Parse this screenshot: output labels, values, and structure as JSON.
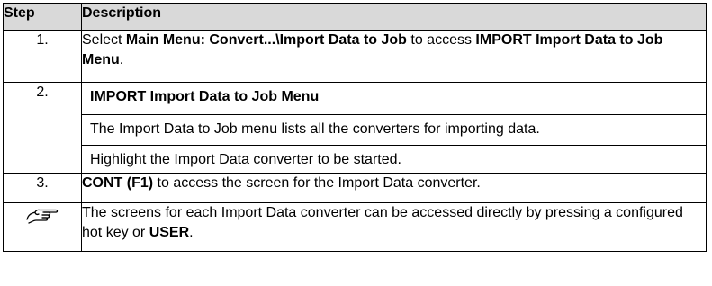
{
  "headers": {
    "step": "Step",
    "description": "Description"
  },
  "rows": [
    {
      "step": "1.",
      "p1_pre": "Select ",
      "p1_b1": "Main Menu: Convert...\\Import Data to Job",
      "p1_mid": " to access ",
      "p1_b2": "IMPORT Import Data to Job Menu",
      "p1_post": "."
    },
    {
      "step": "2.",
      "heading": "IMPORT Import Data to Job Menu",
      "line1": "The Import Data to Job menu lists all the converters for importing data.",
      "line2": "Highlight the Import Data converter to be started."
    },
    {
      "step": "3.",
      "b1": "CONT (F1)",
      "post": " to access the screen for the Import Data converter."
    },
    {
      "icon": "pointing-hand-icon",
      "pre": "The screens for each Import Data converter can be accessed directly by pressing a configured hot key or ",
      "b1": "USER",
      "post": "."
    }
  ]
}
